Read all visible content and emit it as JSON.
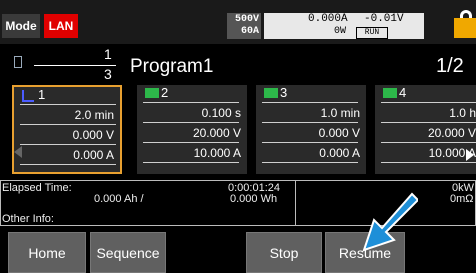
{
  "topbar": {
    "mode_label": "Mode",
    "lan_label": "LAN",
    "range_v": "500V",
    "range_a": "60A",
    "meas_current": "0.000A",
    "meas_voltage": "-0.01V",
    "meas_power": "0W",
    "run_status": "RUN"
  },
  "program": {
    "frac_num": "1",
    "frac_den": "3",
    "name": "Program1",
    "page": "1/2"
  },
  "steps": [
    {
      "num": "1",
      "time": "2.0 min",
      "voltage": "0.000 V",
      "current": "0.000 A"
    },
    {
      "num": "2",
      "time": "0.100 s",
      "voltage": "20.000 V",
      "current": "10.000 A"
    },
    {
      "num": "3",
      "time": "1.0 min",
      "voltage": "0.000 V",
      "current": "0.000 A"
    },
    {
      "num": "4",
      "time": "1.0 h",
      "voltage": "20.000 V",
      "current": "10.000 A"
    }
  ],
  "info": {
    "elapsed_label": "Elapsed Time:",
    "elapsed_time": "0:00:01:24",
    "ah_value": "0.000 Ah /",
    "wh_value": "0.000 Wh",
    "other_label": "Other Info:",
    "kw_value": "0kW",
    "ohm_value": "0mΩ"
  },
  "softkeys": {
    "home": "Home",
    "sequence": "Sequence",
    "stop": "Stop",
    "resume": "Resume"
  },
  "colors": {
    "lan": "#e00000",
    "selection": "#e8a030",
    "battery": "#2db84a",
    "pointer": "#1e8fd8"
  }
}
